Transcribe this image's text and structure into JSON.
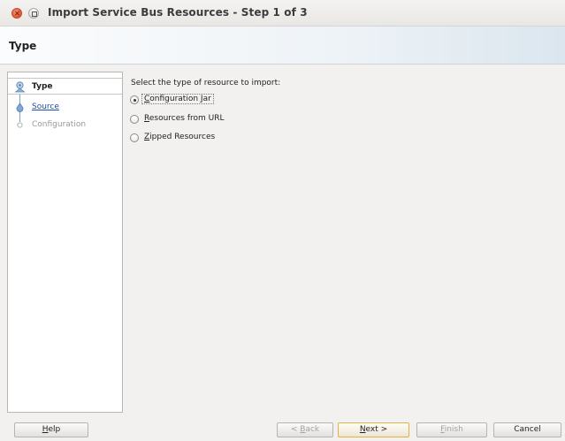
{
  "window": {
    "title": "Import Service Bus Resources - Step 1 of 3"
  },
  "header": {
    "title": "Type"
  },
  "nav": {
    "items": [
      {
        "label": "Type",
        "state": "current"
      },
      {
        "label": "Source",
        "state": "link"
      },
      {
        "label": "Configuration",
        "state": "disabled"
      }
    ]
  },
  "content": {
    "prompt": "Select the type of resource to import:",
    "options": [
      {
        "mnemonic": "C",
        "rest": "onfiguration Jar",
        "checked": true
      },
      {
        "mnemonic": "R",
        "rest": "esources from URL",
        "checked": false
      },
      {
        "mnemonic": "Z",
        "rest": "ipped Resources",
        "checked": false
      }
    ]
  },
  "buttons": {
    "help": {
      "mnemonic": "H",
      "rest": "elp"
    },
    "back": {
      "prefix": "< ",
      "mnemonic": "B",
      "rest": "ack"
    },
    "next": {
      "mnemonic": "N",
      "rest": "ext >"
    },
    "finish": {
      "mnemonic": "F",
      "rest": "inish"
    },
    "cancel": {
      "label": "Cancel"
    }
  },
  "colors": {
    "link": "#1a4fa3",
    "default_button_border": "#e2b24a",
    "close_button": "#e0552e"
  }
}
